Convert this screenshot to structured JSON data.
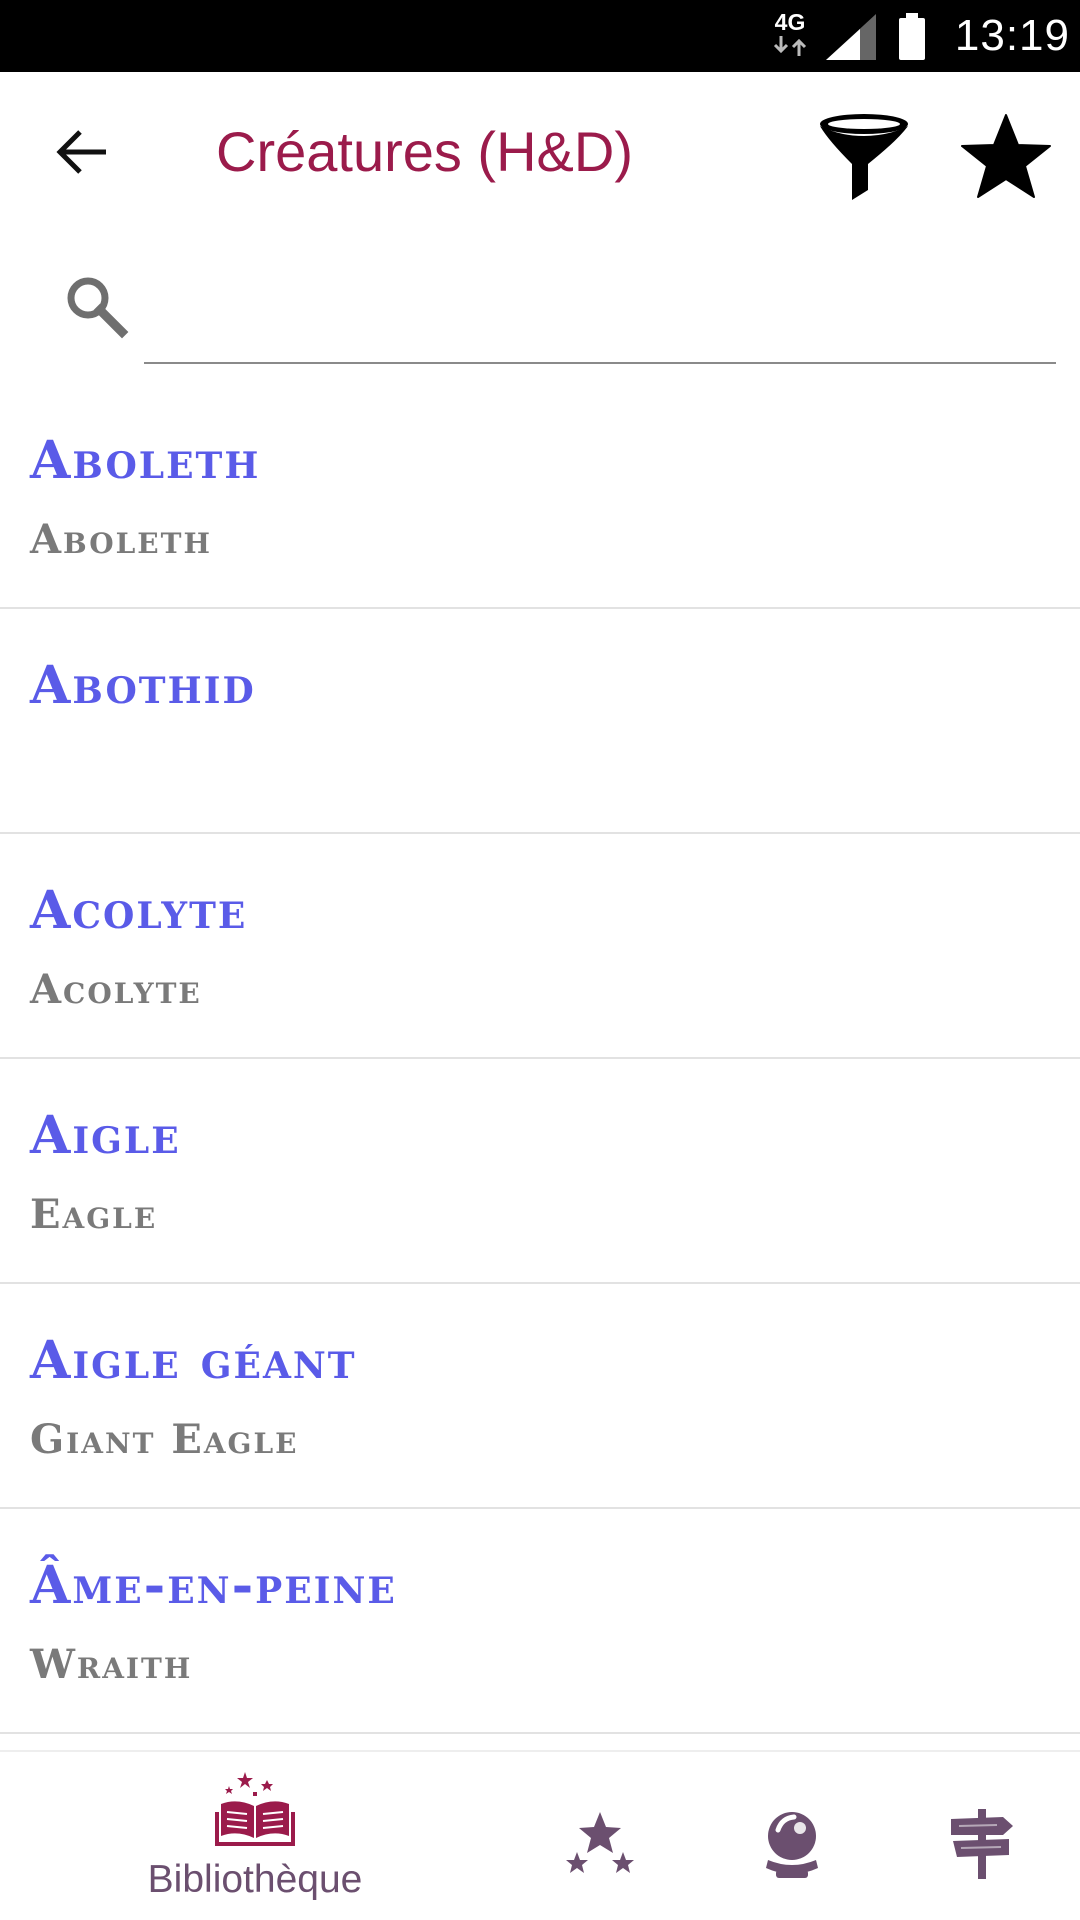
{
  "status_bar": {
    "network": "4G",
    "time": "13:19"
  },
  "app_bar": {
    "title": "Créatures (H&D)"
  },
  "search": {
    "placeholder": "",
    "value": ""
  },
  "creatures": [
    {
      "name_fr": "Aboleth",
      "name_en": "Aboleth"
    },
    {
      "name_fr": "Abothid",
      "name_en": ""
    },
    {
      "name_fr": "Acolyte",
      "name_en": "Acolyte"
    },
    {
      "name_fr": "Aigle",
      "name_en": "Eagle"
    },
    {
      "name_fr": "Aigle géant",
      "name_en": "Giant Eagle"
    },
    {
      "name_fr": "Âme-en-peine",
      "name_en": "Wraith"
    }
  ],
  "bottom_nav": {
    "library_label": "Bibliothèque",
    "items": [
      "library-icon",
      "stars-icon",
      "crystal-ball-icon",
      "signpost-icon"
    ]
  },
  "colors": {
    "title": "#9b1b4b",
    "creature_name": "#5a5be8",
    "creature_subname": "#7a7a7a",
    "nav_icon": "#6b4f6f",
    "nav_active": "#9b1b4b"
  }
}
